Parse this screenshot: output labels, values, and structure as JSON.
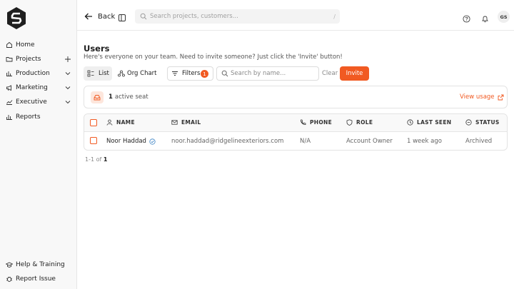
{
  "brand": {
    "logo_icon": "hexagon-s-logo-icon"
  },
  "sidebar": {
    "items": [
      {
        "label": "Home",
        "icon": "home-icon"
      },
      {
        "label": "Projects",
        "icon": "folder-icon",
        "trail": "plus-icon"
      },
      {
        "label": "Production",
        "icon": "bar-chart-icon",
        "trail": "chevron-down-icon"
      },
      {
        "label": "Marketing",
        "icon": "megaphone-icon",
        "trail": "chevron-down-icon"
      },
      {
        "label": "Executive",
        "icon": "trend-line-icon",
        "trail": "chevron-down-icon"
      },
      {
        "label": "Reports",
        "icon": "bar-chart-icon"
      }
    ],
    "footer": [
      {
        "label": "Help & Training",
        "icon": "graduation-cap-icon"
      },
      {
        "label": "Report Issue",
        "icon": "bug-icon"
      }
    ]
  },
  "topbar": {
    "back_label": "Back",
    "search_placeholder": "Search projects, customers...",
    "search_shortcut": "/",
    "avatar_initials": "GS"
  },
  "page": {
    "title": "Users",
    "subtitle": "Here's everyone on your team. Need to invite someone? Just click the 'Invite' button!"
  },
  "toolbar": {
    "list_label": "List",
    "org_chart_label": "Org Chart",
    "filters_label": "Filters",
    "filters_count": "1",
    "name_search_placeholder": "Search by name...",
    "clear_label": "Clear",
    "invite_label": "Invite"
  },
  "seats": {
    "count": "1",
    "label": "active seat",
    "view_usage": "View usage"
  },
  "table": {
    "columns": [
      {
        "label": "NAME",
        "icon": "user-icon"
      },
      {
        "label": "EMAIL",
        "icon": "mail-icon"
      },
      {
        "label": "PHONE",
        "icon": "phone-icon"
      },
      {
        "label": "ROLE",
        "icon": "shield-icon"
      },
      {
        "label": "LAST SEEN",
        "icon": "clock-icon"
      },
      {
        "label": "STATUS",
        "icon": "status-circle-icon"
      }
    ],
    "rows": [
      {
        "name": "Noor Haddad",
        "email": "noor.haddad@ridgelineexteriors.com",
        "phone": "N/A",
        "role": "Account Owner",
        "last_seen": "1 week ago",
        "status": "Archived"
      }
    ]
  },
  "pagination": {
    "range": "1-1",
    "of_label": "of",
    "total": "1"
  },
  "colors": {
    "accent": "#f15a22",
    "sidebar_bg": "#f8f8f8"
  }
}
